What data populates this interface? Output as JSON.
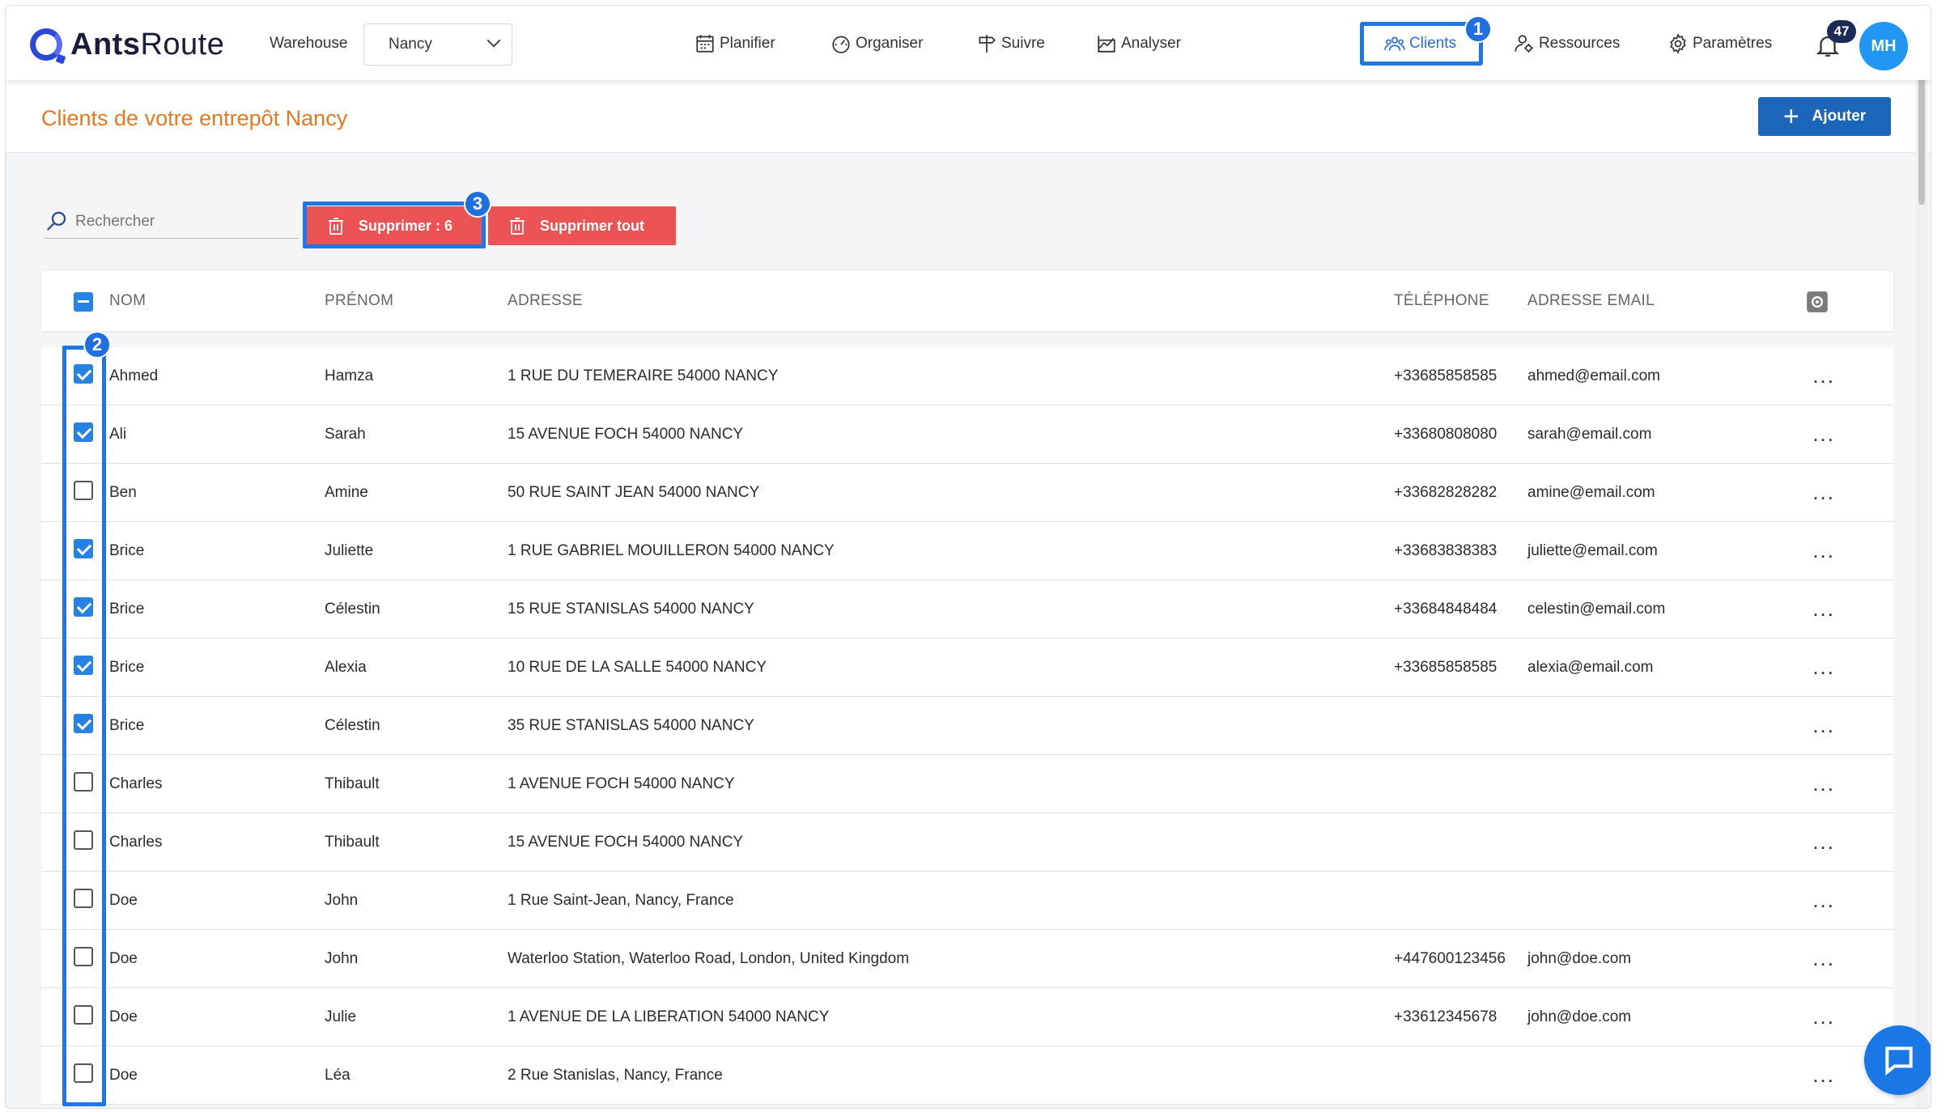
{
  "app": {
    "logo_bold": "Ants",
    "logo_light": "Route"
  },
  "warehouse": {
    "label": "Warehouse",
    "selected": "Nancy"
  },
  "nav": {
    "planifier": "Planifier",
    "organiser": "Organiser",
    "suivre": "Suivre",
    "analyser": "Analyser",
    "clients": "Clients",
    "ressources": "Ressources",
    "parametres": "Paramètres"
  },
  "notifications": {
    "count": "47"
  },
  "user": {
    "initials": "MH"
  },
  "steps": {
    "one": "1",
    "two": "2",
    "three": "3"
  },
  "page": {
    "title": "Clients de votre entrepôt Nancy",
    "add_label": "Ajouter"
  },
  "toolbar": {
    "search_placeholder": "Rechercher",
    "delete_selected": "Supprimer : 6",
    "delete_all": "Supprimer tout"
  },
  "table": {
    "headers": {
      "nom": "NOM",
      "prenom": "PRÉNOM",
      "adresse": "ADRESSE",
      "telephone": "TÉLÉPHONE",
      "email": "ADRESSE EMAIL"
    },
    "rows": [
      {
        "checked": true,
        "nom": "Ahmed",
        "prenom": "Hamza",
        "adresse": "1 RUE DU TEMERAIRE 54000 NANCY",
        "telephone": "+33685858585",
        "email": "ahmed@email.com"
      },
      {
        "checked": true,
        "nom": "Ali",
        "prenom": "Sarah",
        "adresse": "15 AVENUE FOCH 54000 NANCY",
        "telephone": "+33680808080",
        "email": "sarah@email.com"
      },
      {
        "checked": false,
        "nom": "Ben",
        "prenom": "Amine",
        "adresse": "50 RUE SAINT JEAN 54000 NANCY",
        "telephone": "+33682828282",
        "email": "amine@email.com"
      },
      {
        "checked": true,
        "nom": "Brice",
        "prenom": "Juliette",
        "adresse": "1 RUE GABRIEL MOUILLERON 54000 NANCY",
        "telephone": "+33683838383",
        "email": "juliette@email.com"
      },
      {
        "checked": true,
        "nom": "Brice",
        "prenom": "Célestin",
        "adresse": "15 RUE STANISLAS 54000 NANCY",
        "telephone": "+33684848484",
        "email": "celestin@email.com"
      },
      {
        "checked": true,
        "nom": "Brice",
        "prenom": "Alexia",
        "adresse": "10 RUE DE LA SALLE 54000 NANCY",
        "telephone": "+33685858585",
        "email": "alexia@email.com"
      },
      {
        "checked": true,
        "nom": "Brice",
        "prenom": "Célestin",
        "adresse": "35 RUE STANISLAS 54000 NANCY",
        "telephone": "",
        "email": ""
      },
      {
        "checked": false,
        "nom": "Charles",
        "prenom": "Thibault",
        "adresse": "1 AVENUE FOCH 54000 NANCY",
        "telephone": "",
        "email": ""
      },
      {
        "checked": false,
        "nom": "Charles",
        "prenom": "Thibault",
        "adresse": "15 AVENUE FOCH 54000 NANCY",
        "telephone": "",
        "email": ""
      },
      {
        "checked": false,
        "nom": "Doe",
        "prenom": "John",
        "adresse": "1 Rue Saint-Jean, Nancy, France",
        "telephone": "",
        "email": ""
      },
      {
        "checked": false,
        "nom": "Doe",
        "prenom": "John",
        "adresse": "Waterloo Station, Waterloo Road, London, United Kingdom",
        "telephone": "+447600123456",
        "email": "john@doe.com"
      },
      {
        "checked": false,
        "nom": "Doe",
        "prenom": "Julie",
        "adresse": "1 AVENUE DE LA LIBERATION 54000 NANCY",
        "telephone": "+33612345678",
        "email": "john@doe.com"
      },
      {
        "checked": false,
        "nom": "Doe",
        "prenom": "Léa",
        "adresse": "2 Rue Stanislas, Nancy, France",
        "telephone": "",
        "email": ""
      }
    ],
    "row_menu": "..."
  },
  "colors": {
    "accent": "#1f77e6",
    "title_orange": "#e8781f",
    "danger": "#ec5354",
    "primary_button": "#1b66b8"
  },
  "icons": [
    "calendar-icon",
    "gauge-icon",
    "signpost-icon",
    "chart-icon",
    "users-icon",
    "user-gear-icon",
    "gear-icon",
    "bell-icon",
    "search-icon",
    "trash-icon",
    "chat-icon"
  ]
}
